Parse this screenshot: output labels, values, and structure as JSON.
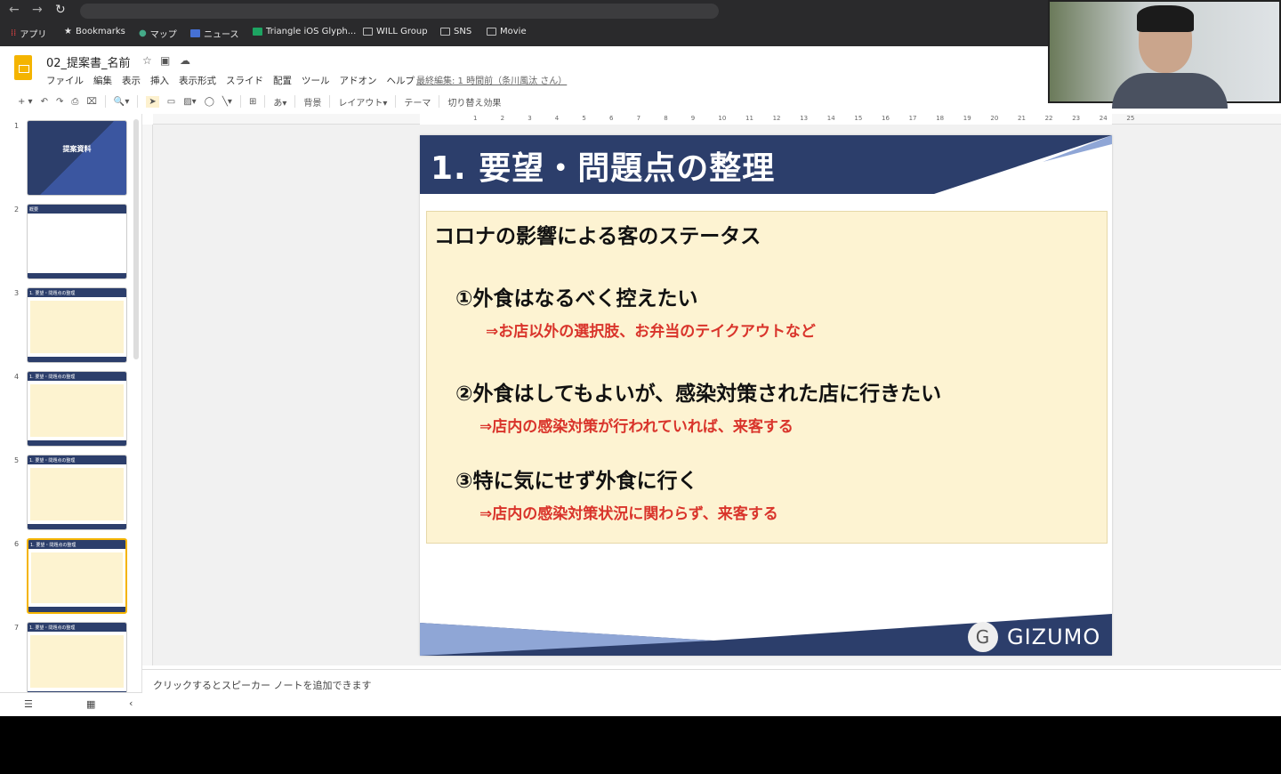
{
  "browser": {
    "bookmarks": [
      "アプリ",
      "Bookmarks",
      "マップ",
      "ニュース",
      "Triangle iOS Glyph...",
      "WILL Group",
      "SNS",
      "Movie"
    ]
  },
  "doc": {
    "title": "02_提案書_名前",
    "last_edit": "最終編集: 1 時間前（条川風汰 さん）",
    "menu": [
      "ファイル",
      "編集",
      "表示",
      "挿入",
      "表示形式",
      "スライド",
      "配置",
      "ツール",
      "アドオン",
      "ヘルプ"
    ]
  },
  "toolbar": {
    "background": "背景",
    "layout": "レイアウト▾",
    "theme": "テーマ",
    "transition": "切り替え効果",
    "zoom": "🔍▾",
    "font": "あ▾"
  },
  "ruler": [
    "1",
    "2",
    "3",
    "4",
    "5",
    "6",
    "7",
    "8",
    "9",
    "10",
    "11",
    "12",
    "13",
    "14",
    "15",
    "16",
    "17",
    "18",
    "19",
    "20",
    "21",
    "22",
    "23",
    "24",
    "25"
  ],
  "filmstrip": {
    "thumbs": [
      {
        "num": "1",
        "title": "提案資料"
      },
      {
        "num": "2",
        "title": "概要"
      },
      {
        "num": "3",
        "title": "1. 要望・問題点の整理"
      },
      {
        "num": "4",
        "title": "1. 要望・問題点の整理"
      },
      {
        "num": "5",
        "title": "1. 要望・問題点の整理"
      },
      {
        "num": "6",
        "title": "1. 要望・問題点の整理"
      },
      {
        "num": "7",
        "title": "1. 要望・問題点の整理"
      }
    ],
    "active": 6
  },
  "slide": {
    "title": "1. 要望・問題点の整理",
    "heading": "コロナの影響による客のステータス",
    "items": [
      {
        "main": "①外食はなるべく控えたい",
        "sub": "⇒お店以外の選択肢、お弁当のテイクアウトなど"
      },
      {
        "main": "②外食はしてもよいが、感染対策された店に行きたい",
        "sub": "⇒店内の感染対策が行われていれば、来客する"
      },
      {
        "main": "③特に気にせず外食に行く",
        "sub": "⇒店内の感染対策状況に関わらず、来客する"
      }
    ],
    "logo": "GIZUMO"
  },
  "notes": {
    "placeholder": "クリックするとスピーカー ノートを追加できます"
  },
  "colors": {
    "navy": "#2c3e6b",
    "accent_red": "#d9342b",
    "box": "#fdf3d2"
  }
}
